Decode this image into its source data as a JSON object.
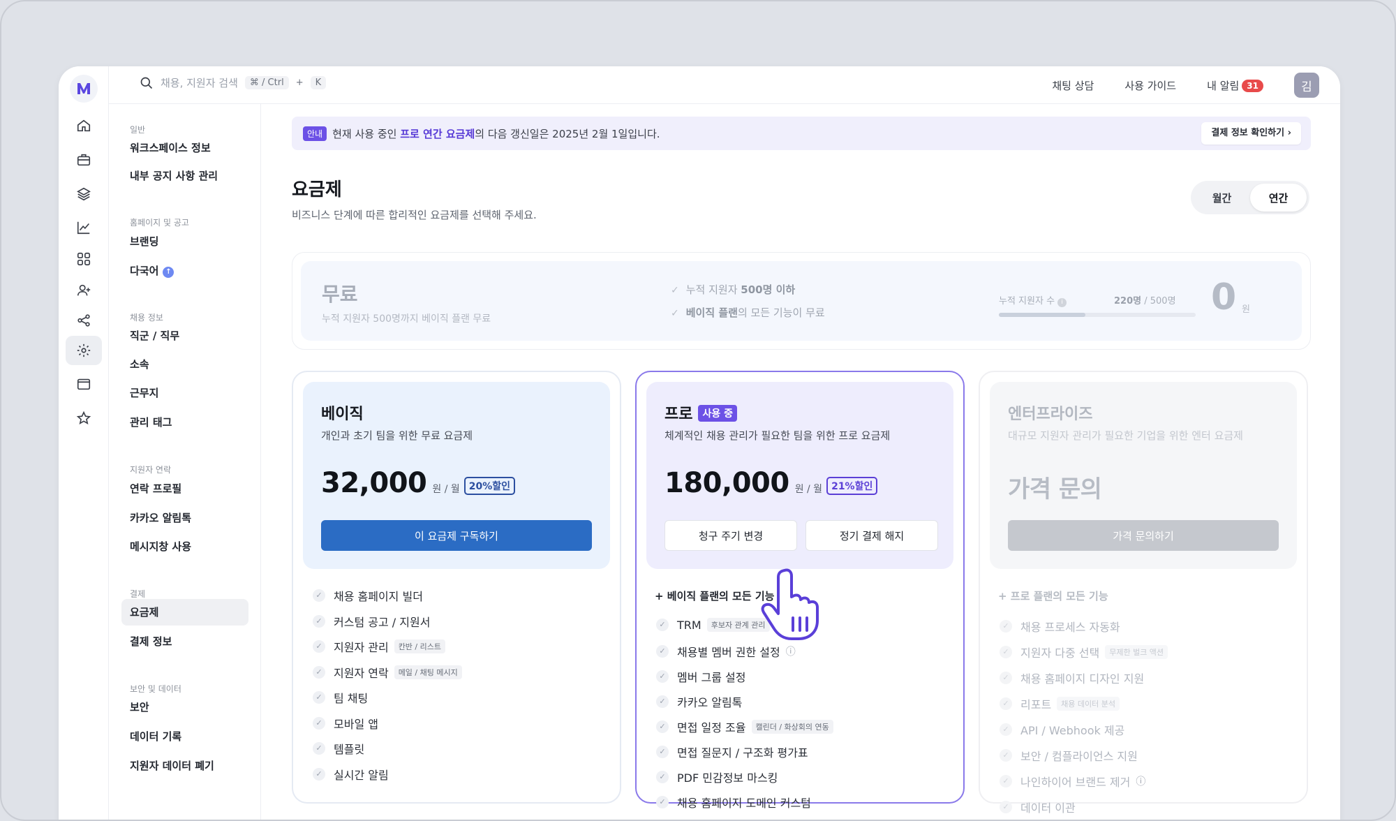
{
  "topbar": {
    "search_placeholder": "채용, 지원자 검색",
    "kbd_key1": "⌘ / Ctrl",
    "kbd_plus": "+",
    "kbd_key2": "K",
    "links": [
      "채팅 상담",
      "사용 가이드"
    ],
    "alerts_label": "내 알림",
    "alerts_count": "31",
    "avatar": "김"
  },
  "rail_icons": [
    "home-icon",
    "briefcase-icon",
    "layers-icon",
    "chart-icon",
    "grid-icon",
    "user-plus-icon",
    "share-icon",
    "gear-icon",
    "window-icon",
    "star-icon"
  ],
  "sidebar": {
    "sections": [
      "일반",
      "홈페이지 및 공고",
      "채용 정보",
      "지원자 연락",
      "결제",
      "보안 및 데이터"
    ],
    "items": [
      "워크스페이스 정보",
      "내부 공지 사항 관리",
      "브랜딩",
      "다국어",
      "직군 / 직무",
      "소속",
      "근무지",
      "관리 태그",
      "연락 프로필",
      "카카오 알림톡",
      "메시지창 사용",
      "요금제",
      "결제 정보",
      "보안",
      "데이터 기록",
      "지원자 데이터 폐기"
    ],
    "active": "요금제"
  },
  "notice": {
    "tag": "안내",
    "text_prefix": "현재 사용 중인 ",
    "plan": "프로 연간 요금제",
    "text_suffix": "의 다음 갱신일은 2025년 2월 1일입니다.",
    "button": "결제 정보 확인하기"
  },
  "page": {
    "title": "요금제",
    "subtitle": "비즈니스 단계에 따른 합리적인 요금제를 선택해 주세요.",
    "toggle": [
      "월간",
      "연간"
    ],
    "toggle_selected": "연간"
  },
  "free_plan": {
    "name": "무료",
    "desc": "누적 지원자 500명까지 베이직 플랜 무료",
    "checks": [
      {
        "pre": "누적 지원자 ",
        "bold": "500명 이하",
        "post": ""
      },
      {
        "pre": "",
        "bold": "베이직 플랜",
        "post": "의 모든 기능이 무료"
      }
    ],
    "count_label": "누적 지원자 수",
    "count_value": "220명",
    "count_max": "/ 500명",
    "usage_fraction": 0.44,
    "price": "0",
    "price_unit": "원"
  },
  "plans": {
    "basic": {
      "name": "베이직",
      "desc": "개인과 초기 팀을 위한 무료 요금제",
      "price": "32,000",
      "unit": "원 / 월",
      "discount": "20%할인",
      "button": "이 요금제 구독하기",
      "features": [
        {
          "label": "채용 홈페이지 빌더",
          "tag": ""
        },
        {
          "label": "커스텀 공고 / 지원서",
          "tag": ""
        },
        {
          "label": "지원자 관리",
          "tag": "칸반 / 리스트"
        },
        {
          "label": "지원자 연락",
          "tag": "메일 / 채팅 메시지"
        },
        {
          "label": "팀 채팅",
          "tag": ""
        },
        {
          "label": "모바일 앱",
          "tag": ""
        },
        {
          "label": "템플릿",
          "tag": ""
        },
        {
          "label": "실시간 알림",
          "tag": ""
        }
      ]
    },
    "pro": {
      "name": "프로",
      "badge": "사용 중",
      "desc": "체계적인 채용 관리가 필요한 팀을 위한 프로 요금제",
      "price": "180,000",
      "unit": "원 / 월",
      "discount": "21%할인",
      "button_change": "청구 주기 변경",
      "button_cancel": "정기 결제 해지",
      "includes": "+ 베이직 플랜의 모든 기능",
      "features": [
        {
          "label": "TRM",
          "tag": "후보자 관계 관리"
        },
        {
          "label": "채용별 멤버 권한 설정",
          "tag": "",
          "info": true
        },
        {
          "label": "멤버 그룹 설정",
          "tag": ""
        },
        {
          "label": "카카오 알림톡",
          "tag": ""
        },
        {
          "label": "면접 일정 조율",
          "tag": "캘린더 / 화상회의 연동"
        },
        {
          "label": "면접 질문지 / 구조화 평가표",
          "tag": ""
        },
        {
          "label": "PDF 민감정보 마스킹",
          "tag": ""
        },
        {
          "label": "채용 홈페이지 도메인 커스텀",
          "tag": ""
        }
      ]
    },
    "enterprise": {
      "name": "엔터프라이즈",
      "desc": "대규모 지원자 관리가 필요한 기업을 위한 엔터 요금제",
      "price": "가격 문의",
      "button": "가격 문의하기",
      "includes": "+ 프로 플랜의 모든 기능",
      "features": [
        {
          "label": "채용 프로세스 자동화",
          "tag": ""
        },
        {
          "label": "지원자 다중 선택",
          "tag": "무제한 벌크 액션"
        },
        {
          "label": "채용 홈페이지 디자인 지원",
          "tag": ""
        },
        {
          "label": "리포트",
          "tag": "채용 데이터 분석"
        },
        {
          "label": "API / Webhook 제공",
          "tag": ""
        },
        {
          "label": "보안 / 컴플라이언스 지원",
          "tag": ""
        },
        {
          "label": "나인하이어 브랜드 제거",
          "tag": "",
          "info": true
        },
        {
          "label": "데이터 이관",
          "tag": ""
        }
      ]
    }
  },
  "colors": {
    "accent": "#6c51e6",
    "primary_button": "#2b6cc4",
    "pro_border": "#8a79ea",
    "basic_bg": "#eaf2fd",
    "pro_bg": "#eeedfd",
    "enterprise_bg": "#f5f6f8"
  }
}
